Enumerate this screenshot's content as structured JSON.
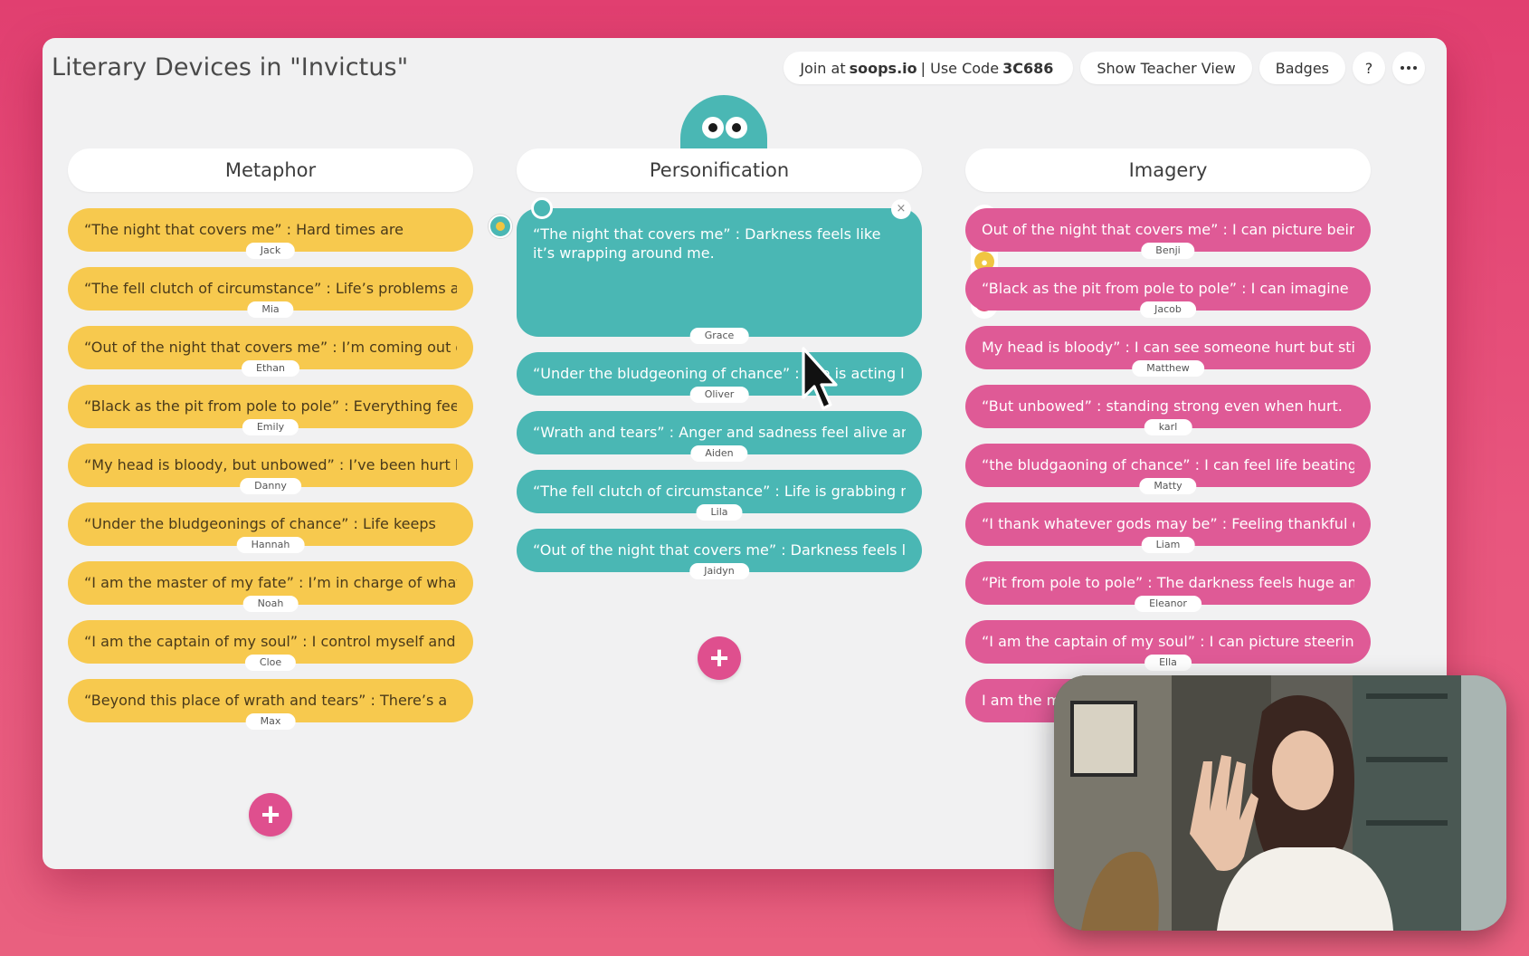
{
  "header": {
    "title": "Literary Devices in \"Invictus\"",
    "join_prefix": "Join at",
    "join_site": "soops.io",
    "join_mid": "| Use Code",
    "join_code": "3C686",
    "teacher_view": "Show Teacher View",
    "badges": "Badges",
    "help": "?"
  },
  "columns": [
    {
      "title": "Metaphor",
      "cards": [
        {
          "text": "“The night that covers me” : Hard times are",
          "author": "Jack"
        },
        {
          "text": "“The fell clutch of circumstance” : Life’s problems are",
          "author": "Mia"
        },
        {
          "text": "“Out of the night that covers me” : I’m coming out of",
          "author": "Ethan"
        },
        {
          "text": "“Black as the pit from pole to pole” : Everything feels",
          "author": "Emily"
        },
        {
          "text": "“My head is bloody, but unbowed” : I’ve been hurt but",
          "author": "Danny"
        },
        {
          "text": "“Under the bludgeonings of chance” : Life keeps",
          "author": "Hannah"
        },
        {
          "text": "“I am the master of my fate” : I’m in charge of what",
          "author": "Noah"
        },
        {
          "text": "“I am the captain of my soul” : I control myself and my",
          "author": "Cloe"
        },
        {
          "text": "“Beyond this place of wrath and tears” : There’s a",
          "author": "Max"
        }
      ]
    },
    {
      "title": "Personification",
      "cards": [
        {
          "text": "“The night that covers me” : Darkness feels like it’s wrapping around me.",
          "author": "Grace"
        },
        {
          "text": "“Under the bludgeoning of chance” : Life is acting like",
          "author": "Oliver"
        },
        {
          "text": "“Wrath and tears” : Anger and sadness feel alive and",
          "author": "Aiden"
        },
        {
          "text": "“The fell clutch of circumstance” : Life is grabbing me",
          "author": "Lila"
        },
        {
          "text": "“Out of the night that covers me” : Darkness feels like",
          "author": "Jaidyn"
        }
      ]
    },
    {
      "title": "Imagery",
      "cards": [
        {
          "text": "Out of the night that covers me” : I can picture being",
          "author": "Benji"
        },
        {
          "text": "“Black as the pit from pole to pole” : I can imagine",
          "author": "Jacob"
        },
        {
          "text": "My head is bloody” : I can see someone hurt but still",
          "author": "Matthew"
        },
        {
          "text": "“But unbowed” : standing strong even when hurt.",
          "author": "karl"
        },
        {
          "text": "“the bludgaoning of chance” : I can feel life beating",
          "author": "Matty"
        },
        {
          "text": "“I thank whatever gods may be” : Feeling thankful or",
          "author": "Liam"
        },
        {
          "text": "“Pit from pole to pole” : The darkness feels huge and",
          "author": "Eleanor"
        },
        {
          "text": "“I am the captain of my soul” : I can picture steering",
          "author": "Ella"
        },
        {
          "text": "I am the mas",
          "author": ""
        }
      ]
    }
  ],
  "add_label": "+",
  "close_label": "×",
  "colors": {
    "background": "#e13f70",
    "metaphor": "#f7c94e",
    "personification": "#4ab7b4",
    "imagery": "#df5a96",
    "add_button": "#df4f8e"
  },
  "icons": [
    "thumbs-up-icon",
    "lightbulb-icon",
    "question-icon",
    "target-icon",
    "more-icon",
    "cursor-icon"
  ]
}
